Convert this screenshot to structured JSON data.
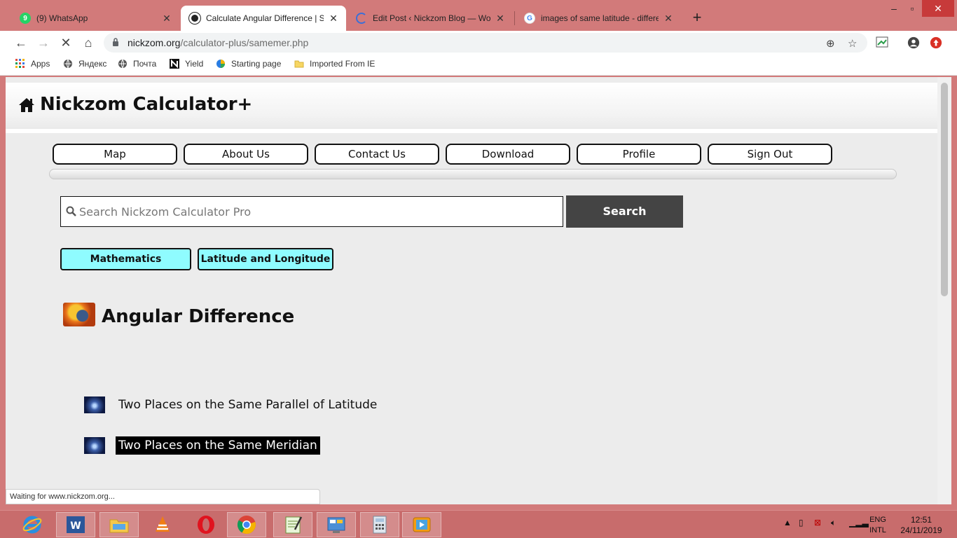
{
  "browser": {
    "tabs": [
      {
        "title": "(9) WhatsApp",
        "icon": "whatsapp-icon",
        "active": false
      },
      {
        "title": "Calculate Angular Difference | Sa",
        "icon": "nickzom-icon",
        "active": true
      },
      {
        "title": "Edit Post ‹ Nickzom Blog — Word",
        "icon": "loading-spinner-icon",
        "active": false
      },
      {
        "title": "images of same latitude - differe",
        "icon": "google-icon",
        "active": false
      }
    ],
    "url_host": "nickzom.org",
    "url_path": "/calculator-plus/samemer.php",
    "bookmarks": [
      "Apps",
      "Яндекс",
      "Почта",
      "Yield",
      "Starting page",
      "Imported From IE"
    ],
    "status_text": "Waiting for www.nickzom.org..."
  },
  "site": {
    "brand": "Nickzom Calculator+",
    "nav": [
      "Map",
      "About Us",
      "Contact Us",
      "Download",
      "Profile",
      "Sign Out"
    ],
    "search": {
      "placeholder": "Search Nickzom Calculator Pro",
      "button": "Search"
    },
    "categories": [
      "Mathematics",
      "Latitude and Longitude"
    ],
    "topic_title": "Angular Difference",
    "links": [
      {
        "text": "Two Places on the Same Parallel of Latitude",
        "highlighted": false
      },
      {
        "text": "Two Places on the Same Meridian",
        "highlighted": true
      }
    ],
    "accent_color": "#8ffcff",
    "search_button_color": "#444444"
  },
  "taskbar": {
    "apps": [
      "internet-explorer-icon",
      "word-icon",
      "file-explorer-icon",
      "vlc-icon",
      "opera-icon",
      "chrome-icon",
      "notepad-icon",
      "control-panel-icon",
      "calculator-icon",
      "media-player-icon"
    ],
    "lang_top": "ENG",
    "lang_bottom": "INTL",
    "time": "12:51",
    "date": "24/11/2019"
  }
}
